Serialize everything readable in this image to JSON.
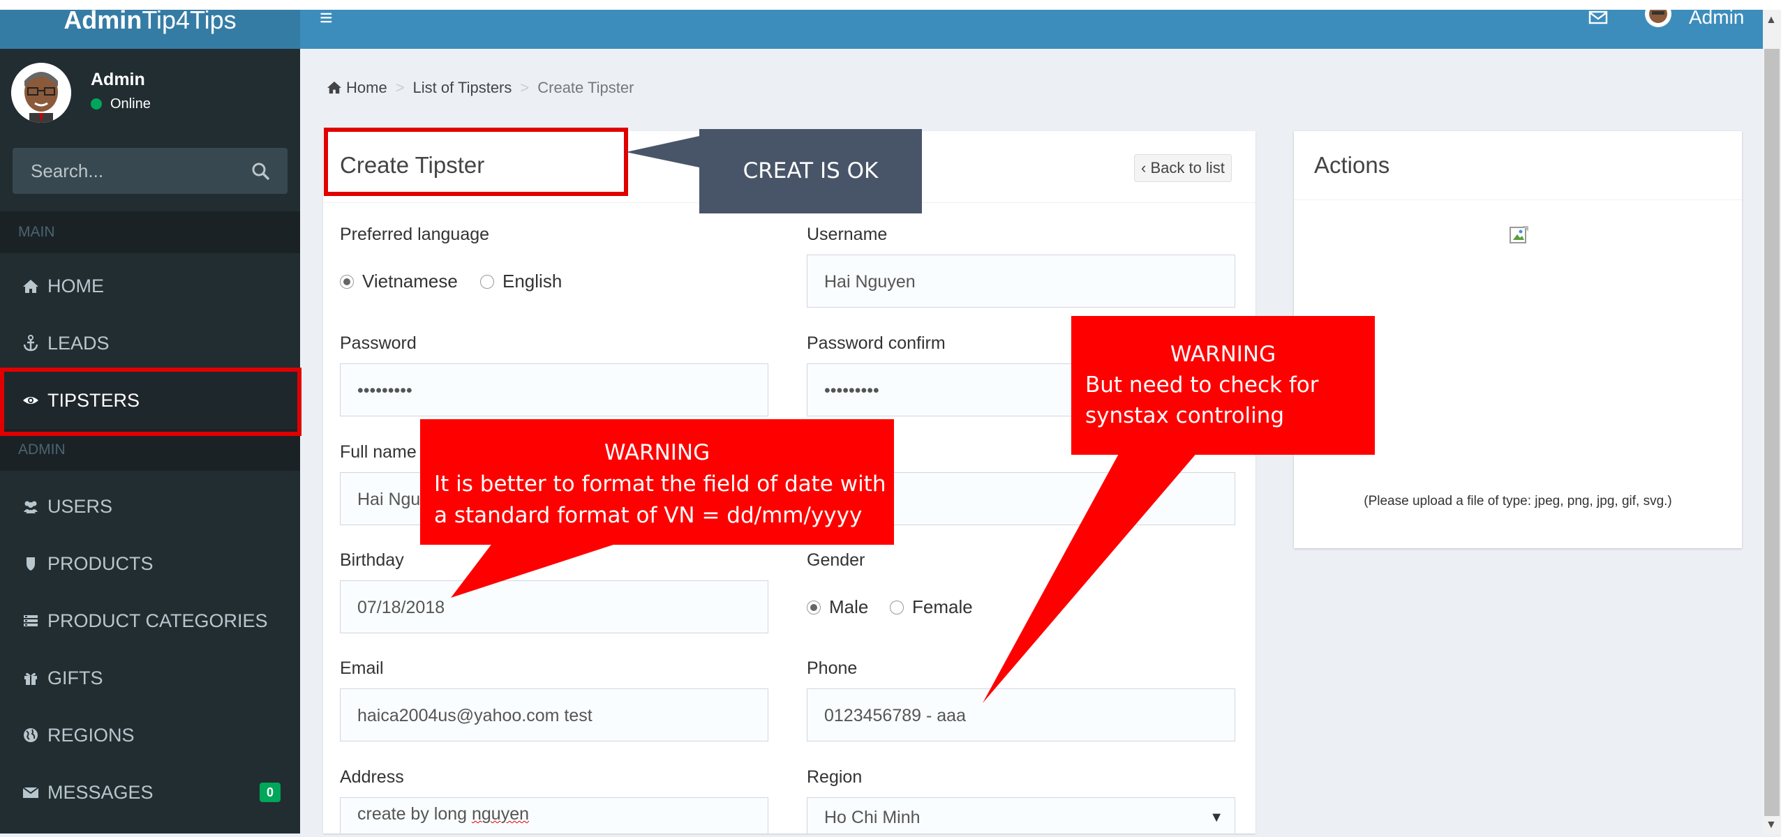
{
  "header": {
    "logo_bold": "Admin",
    "logo_light": "Tip4Tips",
    "menu_icon": "hamburger-icon",
    "user_name": "Admin"
  },
  "sidebar": {
    "user": {
      "name": "Admin",
      "status": "Online"
    },
    "search_placeholder": "Search...",
    "sections": {
      "main": "MAIN",
      "admin": "ADMIN"
    },
    "items": [
      {
        "label": "HOME",
        "icon": "home-icon"
      },
      {
        "label": "LEADS",
        "icon": "anchor-icon"
      },
      {
        "label": "TIPSTERS",
        "icon": "eye-icon",
        "active": true
      },
      {
        "label": "USERS",
        "icon": "users-icon"
      },
      {
        "label": "PRODUCTS",
        "icon": "shield-icon"
      },
      {
        "label": "PRODUCT CATEGORIES",
        "icon": "list-icon"
      },
      {
        "label": "GIFTS",
        "icon": "gift-icon"
      },
      {
        "label": "REGIONS",
        "icon": "globe-icon"
      },
      {
        "label": "MESSAGES",
        "icon": "envelope-icon",
        "badge": "0"
      }
    ]
  },
  "breadcrumb": {
    "home": "Home",
    "list": "List of Tipsters",
    "current": "Create Tipster"
  },
  "form": {
    "title": "Create Tipster",
    "back_label": "‹ Back to list",
    "preferred_language": {
      "label": "Preferred language",
      "options": [
        "Vietnamese",
        "English"
      ],
      "selected": "Vietnamese"
    },
    "username": {
      "label": "Username",
      "value": "Hai Nguyen"
    },
    "password": {
      "label": "Password",
      "value": "•••••••••"
    },
    "password_confirm": {
      "label": "Password confirm",
      "value": "•••••••••"
    },
    "full_name": {
      "label": "Full name",
      "value": "Hai Nguyen"
    },
    "birthday": {
      "label": "Birthday",
      "value": "07/18/2018"
    },
    "gender": {
      "label": "Gender",
      "options": [
        "Male",
        "Female"
      ],
      "selected": "Male"
    },
    "email": {
      "label": "Email",
      "value": "haica2004us@yahoo.com test"
    },
    "phone": {
      "label": "Phone",
      "value": "0123456789 - aaa"
    },
    "address": {
      "label": "Address",
      "value_plain": "create by long ",
      "value_squiggle": "nguyen"
    },
    "region": {
      "label": "Region",
      "value": "Ho Chi Minh"
    }
  },
  "actions": {
    "title": "Actions",
    "upload_hint": "(Please upload a file of type: jpeg, png, jpg, gif, svg.)"
  },
  "annotations": {
    "create_ok": "CREAT IS OK",
    "warning_date": {
      "heading": "WARNING",
      "line1": "It is better to format the field of date with",
      "line2": "a standard format of VN = dd/mm/yyyy"
    },
    "warning_phone": {
      "heading": "WARNING",
      "line1": "But need to check for",
      "line2": "synstax controling"
    }
  },
  "colors": {
    "header": "#3c8dbc",
    "logo": "#357ca5",
    "sidebar": "#222d32",
    "annotation_red": "#ff0000",
    "annotation_slate": "#485569"
  }
}
